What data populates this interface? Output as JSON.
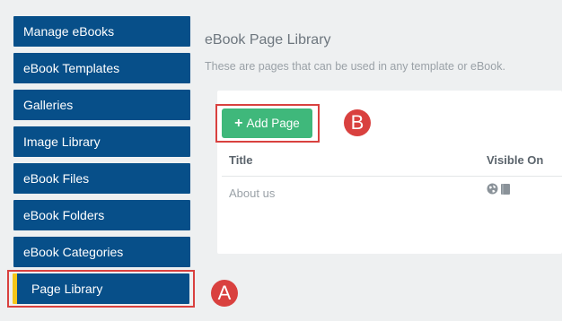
{
  "sidebar": {
    "items": [
      {
        "label": "Manage eBooks"
      },
      {
        "label": "eBook Templates"
      },
      {
        "label": "Galleries"
      },
      {
        "label": "Image Library"
      },
      {
        "label": "eBook Files"
      },
      {
        "label": "eBook Folders"
      },
      {
        "label": "eBook Categories"
      },
      {
        "label": "Page Library",
        "active": true
      }
    ]
  },
  "main": {
    "title": "eBook Page Library",
    "subtitle": "These are pages that can be used in any template or eBook.",
    "add_button_label": "Add Page",
    "table": {
      "columns": [
        "Title",
        "Visible On"
      ],
      "rows": [
        {
          "title": "About us",
          "visible_on": [
            "globe-icon",
            "book-icon"
          ]
        }
      ]
    }
  },
  "annotations": {
    "a": "A",
    "b": "B"
  },
  "colors": {
    "sidebar_bg": "#074f89",
    "active_accent": "#f5c518",
    "add_button": "#3fb87b",
    "annotation_red": "#d9413f"
  }
}
